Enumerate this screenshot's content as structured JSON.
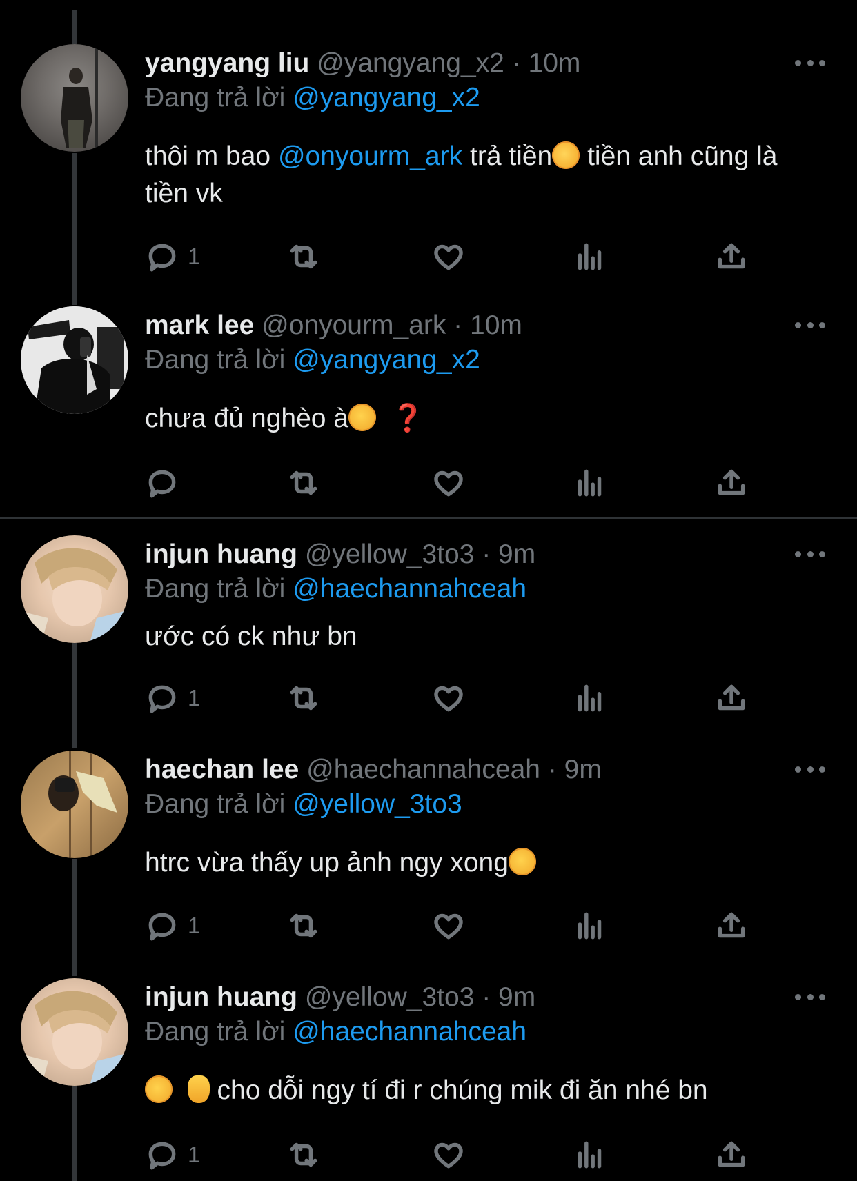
{
  "labels": {
    "replying_to": "Đang trả lời"
  },
  "tweets": [
    {
      "name": "yangyang liu",
      "handle": "@yangyang_x2",
      "time": "10m",
      "reply_to": "@yangyang_x2",
      "text_parts": [
        "thôi m bao ",
        "@onyourm_ark",
        " trả tiền",
        " tiền anh cũng là tiền vk"
      ],
      "replies": "1"
    },
    {
      "name": "mark lee",
      "handle": "@onyourm_ark",
      "time": "10m",
      "reply_to": "@yangyang_x2",
      "text_parts": [
        "chưa đủ nghèo à",
        "❓"
      ],
      "replies": ""
    },
    {
      "name": "injun huang",
      "handle": "@yellow_3to3",
      "time": "9m",
      "reply_to": "@haechannahceah",
      "text_parts": [
        "ước có ck như bn"
      ],
      "replies": "1"
    },
    {
      "name": "haechan lee",
      "handle": "@haechannahceah",
      "time": "9m",
      "reply_to": "@yellow_3to3",
      "text_parts": [
        "htrc vừa thấy up ảnh ngy xong"
      ],
      "replies": "1"
    },
    {
      "name": "injun huang",
      "handle": "@yellow_3to3",
      "time": "9m",
      "reply_to": "@haechannahceah",
      "text_parts": [
        " cho dỗi ngy tí đi r chúng mik đi ăn nhé bn"
      ],
      "replies": "1"
    }
  ],
  "separator": " · ",
  "colors": {
    "background": "#000000",
    "text": "#e7e9ea",
    "secondary": "#71767b",
    "link": "#1d9bf0"
  },
  "icons": [
    "reply-icon",
    "retweet-icon",
    "like-icon",
    "views-icon",
    "share-icon",
    "more-icon"
  ]
}
